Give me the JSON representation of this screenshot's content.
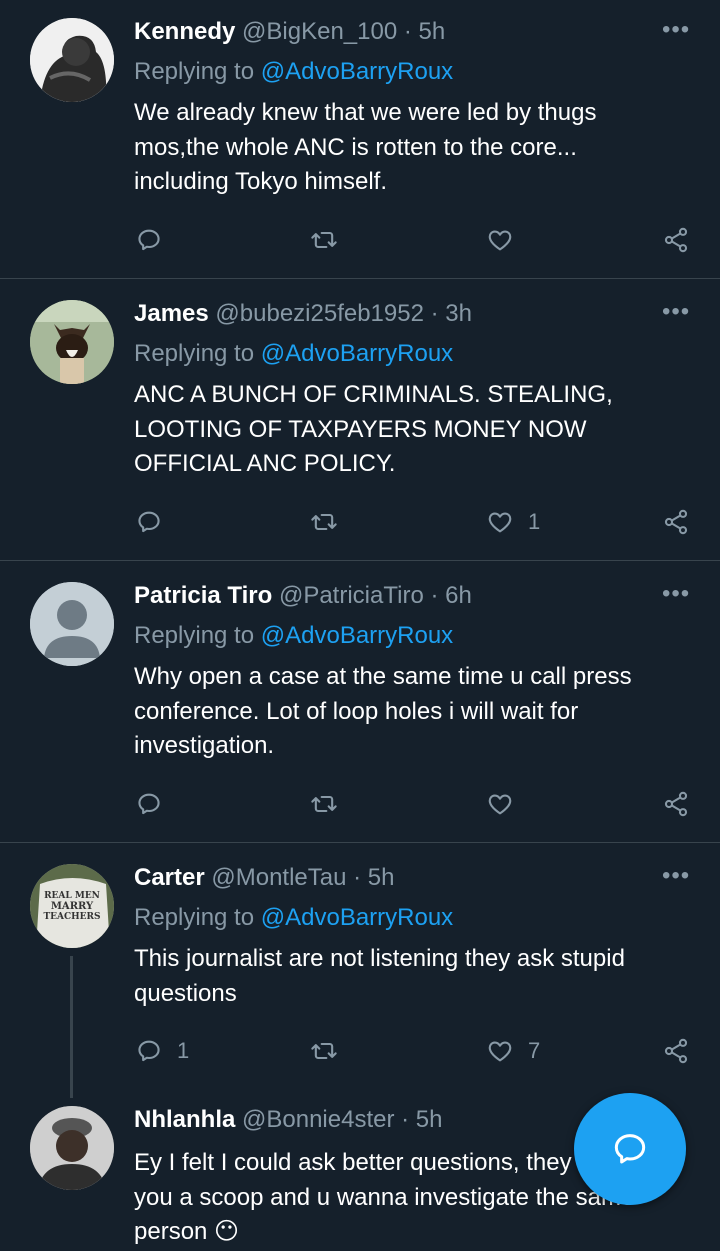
{
  "tweets": [
    {
      "name": "Kennedy",
      "handle": "@BigKen_100",
      "time": "· 5h",
      "reply_prefix": "Replying to ",
      "reply_to": "@AdvoBarryRoux",
      "text": "We already knew that we were led by thugs\nmos,the whole ANC is rotten to the core...\nincluding Tokyo himself.",
      "reply_count": "",
      "like_count": ""
    },
    {
      "name": "James",
      "handle": "@bubezi25feb1952",
      "time": "· 3h",
      "reply_prefix": "Replying to ",
      "reply_to": "@AdvoBarryRoux",
      "text": "ANC A BUNCH OF CRIMINALS. STEALING,\nLOOTING OF TAXPAYERS MONEY NOW\nOFFICIAL ANC POLICY.",
      "reply_count": "",
      "like_count": "1"
    },
    {
      "name": "Patricia Tiro",
      "handle": "@PatriciaTiro",
      "time": "· 6h",
      "reply_prefix": "Replying to ",
      "reply_to": "@AdvoBarryRoux",
      "text": "Why open a case at the same time u call press\nconference. Lot of loop holes i will wait for\ninvestigation.",
      "reply_count": "",
      "like_count": ""
    },
    {
      "name": "Carter",
      "handle": "@MontleTau",
      "time": "· 5h",
      "reply_prefix": "Replying to ",
      "reply_to": "@AdvoBarryRoux",
      "text": "This journalist are not listening they ask stupid\nquestions",
      "reply_count": "1",
      "like_count": "7"
    },
    {
      "name": "Nhlanhla",
      "handle": "@Bonnie4ster",
      "time": "· 5h",
      "text": "Ey I felt I could ask better questions, they\nyou a scoop and u wanna investigate the same\nperson 😶"
    }
  ],
  "avatar_text": "REAL MEN MARRY TEACHERS",
  "icons": {
    "reply": "reply-icon",
    "retweet": "retweet-icon",
    "like": "like-icon",
    "share": "share-icon",
    "more": "more-icon",
    "compose": "compose-reply-icon"
  },
  "colors": {
    "background": "#15202b",
    "accent": "#1da1f2",
    "muted": "#8899a6",
    "divider": "#38444d"
  }
}
